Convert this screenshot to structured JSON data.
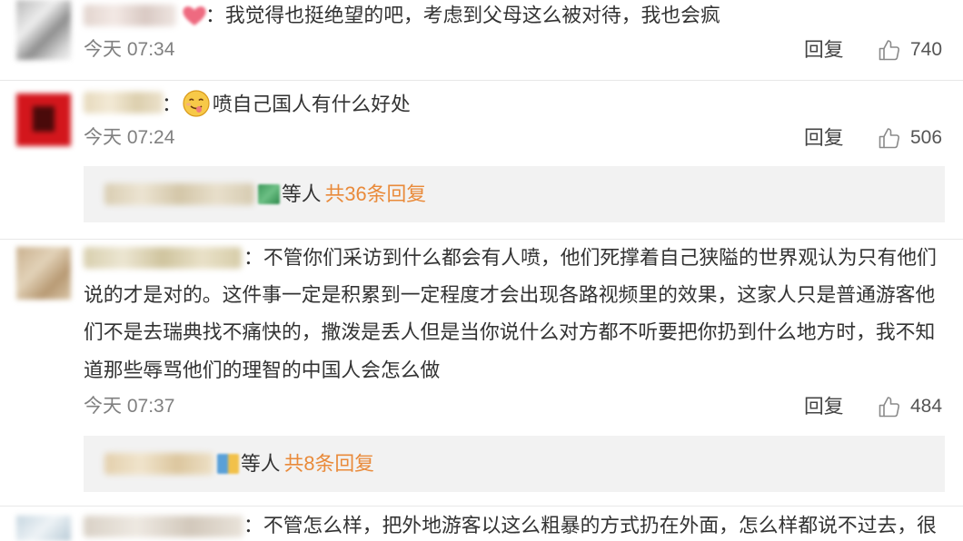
{
  "comments": [
    {
      "user_colon": "：",
      "username_badge_icon": "heart-badge-icon",
      "text": "我觉得也挺绝望的吧，考虑到父母这么被对待，我也会疯",
      "time": "今天 07:34",
      "reply_label": "回复",
      "like_icon": "thumbs-up-icon",
      "likes": "740"
    },
    {
      "user_colon": "：",
      "emoji_icon": "drooling-face-emoji-icon",
      "text": "喷自己国人有什么好处",
      "time": "今天 07:24",
      "reply_label": "回复",
      "like_icon": "thumbs-up-icon",
      "likes": "506",
      "reply_summary": {
        "badge_icon": "user-badge-icon",
        "suffix": "等人",
        "count_label": "共36条回复"
      }
    },
    {
      "user_colon": "：",
      "text_lines": [
        "不管你们采访到什么都会有人喷，他们死撑着自己狭隘的世界观认为只有他们",
        "说的才是对的。这件事一定是积累到一定程度才会出现各路视频里的效果，这家人只是普通游客他",
        "们不是去瑞典找不痛快的，撒泼是丢人但是当你说什么对方都不听要把你扔到什么地方时，我不知",
        "道那些辱骂他们的理智的中国人会怎么做"
      ],
      "time": "今天 07:37",
      "reply_label": "回复",
      "like_icon": "thumbs-up-icon",
      "likes": "484",
      "reply_summary": {
        "badge_icon": "user-badge-icon",
        "suffix": "等人",
        "count_label": "共8条回复"
      }
    },
    {
      "user_colon": "：",
      "text": "不管怎么样，把外地游客以这么粗暴的方式扔在外面，怎么样都说不过去，很"
    }
  ],
  "colors": {
    "text": "#333333",
    "meta_gray": "#808080",
    "reply_link_orange": "#e98a3a",
    "reply_box_bg": "#f2f2f2",
    "separator": "#e8e8e8"
  }
}
